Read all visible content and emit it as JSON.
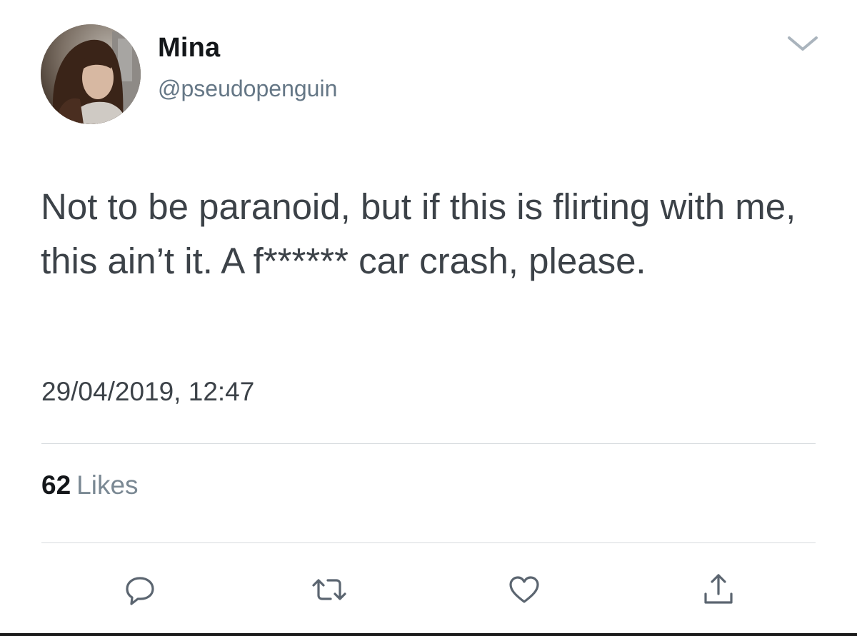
{
  "user": {
    "display_name": "Mina",
    "handle": "@pseudopenguin"
  },
  "tweet": {
    "text": "Not to be paranoid, but if this is flirting with me, this ain’t it. A f****** car crash, please.",
    "timestamp": "29/04/2019, 12:47"
  },
  "stats": {
    "likes_count": "62",
    "likes_label": "Likes"
  },
  "icons": {
    "menu": "chevron-down-icon",
    "reply": "reply-icon",
    "retweet": "retweet-icon",
    "like": "heart-icon",
    "share": "share-icon"
  },
  "colors": {
    "name": "#14171a",
    "handle": "#657786",
    "text": "#3c4248",
    "icon": "#5b6570",
    "divider": "#d7dbdf"
  }
}
